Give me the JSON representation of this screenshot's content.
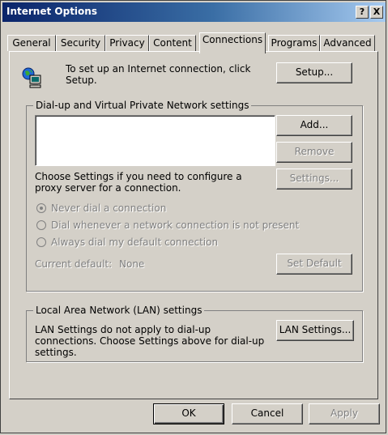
{
  "window": {
    "title": "Internet Options",
    "help_glyph": "?",
    "close_glyph": "X"
  },
  "tabs": [
    {
      "label": "General"
    },
    {
      "label": "Security"
    },
    {
      "label": "Privacy"
    },
    {
      "label": "Content"
    },
    {
      "label": "Connections",
      "active": true
    },
    {
      "label": "Programs"
    },
    {
      "label": "Advanced"
    }
  ],
  "setup": {
    "text": "To set up an Internet connection, click Setup.",
    "button": "Setup..."
  },
  "dialup": {
    "group_label": "Dial-up and Virtual Private Network settings",
    "add_button": "Add...",
    "remove_button": "Remove",
    "proxy_text": "Choose Settings if you need to configure a proxy server for a connection.",
    "settings_button": "Settings...",
    "radio_never": "Never dial a connection",
    "radio_whenever": "Dial whenever a network connection is not present",
    "radio_always": "Always dial my default connection",
    "current_default_label": "Current default:",
    "current_default_value": "None",
    "set_default_button": "Set Default"
  },
  "lan": {
    "group_label": "Local Area Network (LAN) settings",
    "text": "LAN Settings do not apply to dial-up connections. Choose Settings above for dial-up settings.",
    "button": "LAN Settings..."
  },
  "footer": {
    "ok": "OK",
    "cancel": "Cancel",
    "apply": "Apply"
  }
}
